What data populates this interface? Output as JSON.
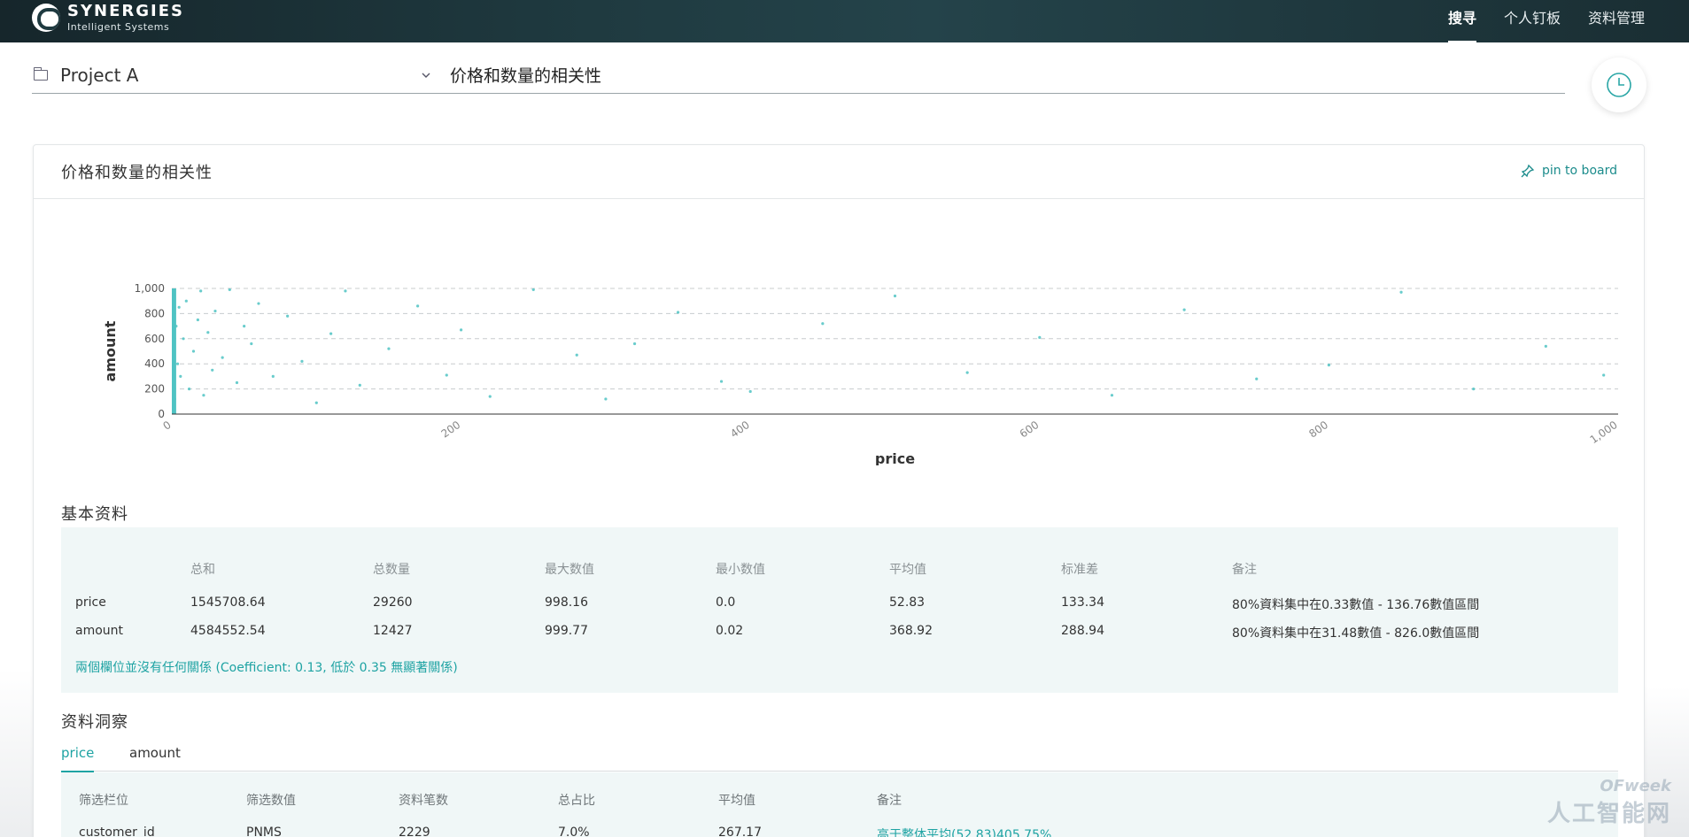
{
  "nav": {
    "brand": "SYNERGIES",
    "brand_sub": "Intelligent Systems",
    "items": [
      {
        "label": "搜寻",
        "active": true
      },
      {
        "label": "个人钉板",
        "active": false
      },
      {
        "label": "资料管理",
        "active": false
      }
    ]
  },
  "query": {
    "project": "Project A",
    "text": "价格和数量的相关性"
  },
  "card": {
    "title": "价格和数量的相关性",
    "pin_label": "pin to board"
  },
  "chart_data": {
    "type": "scatter",
    "xlabel": "price",
    "ylabel": "amount",
    "xlim": [
      0,
      1000
    ],
    "ylim": [
      0,
      1000
    ],
    "x_ticks": [
      "0",
      "200",
      "400",
      "600",
      "800",
      "1,000"
    ],
    "y_ticks": [
      "0",
      "200",
      "400",
      "600",
      "800",
      "1,000"
    ],
    "grid": "horizontal dashed",
    "color": "#4fc3c3",
    "series": [
      {
        "x": [
          1,
          2,
          3,
          4,
          5,
          6,
          8,
          10,
          12,
          15,
          18,
          20,
          22,
          25,
          28,
          30,
          35,
          40,
          45,
          50,
          55,
          60,
          70,
          80,
          90,
          100,
          110,
          120,
          130,
          150,
          170,
          190,
          200,
          220,
          250,
          280,
          300,
          320,
          350,
          380,
          400,
          450,
          500,
          550,
          600,
          650,
          700,
          750,
          800,
          850,
          900,
          950,
          990
        ],
        "y": [
          950,
          120,
          700,
          400,
          850,
          300,
          600,
          900,
          200,
          500,
          750,
          980,
          150,
          650,
          350,
          820,
          450,
          990,
          250,
          700,
          560,
          880,
          300,
          780,
          420,
          90,
          640,
          980,
          230,
          520,
          860,
          310,
          670,
          140,
          990,
          470,
          120,
          560,
          810,
          260,
          180,
          720,
          940,
          330,
          610,
          150,
          830,
          280,
          390,
          970,
          200,
          540,
          310
        ]
      }
    ]
  },
  "basic": {
    "title": "基本资料",
    "headers": [
      "总和",
      "总数量",
      "最大数值",
      "最小数值",
      "平均值",
      "标准差",
      "备注"
    ],
    "rows": [
      {
        "name": "price",
        "cells": [
          "1545708.64",
          "29260",
          "998.16",
          "0.0",
          "52.83",
          "133.34",
          "80%資料集中在0.33數值 - 136.76數值區間"
        ]
      },
      {
        "name": "amount",
        "cells": [
          "4584552.54",
          "12427",
          "999.77",
          "0.02",
          "368.92",
          "288.94",
          "80%資料集中在31.48數值 - 826.0數值區間"
        ]
      }
    ],
    "note": "兩個欄位並沒有任何關係 (Coefficient: 0.13, 低於 0.35 無顯著關係)"
  },
  "insight": {
    "title": "资料洞察",
    "tabs": [
      {
        "label": "price",
        "active": true
      },
      {
        "label": "amount",
        "active": false
      }
    ],
    "headers": [
      "筛选栏位",
      "筛选数值",
      "资料笔数",
      "总占比",
      "平均值",
      "备注"
    ],
    "rows": [
      {
        "cells": [
          "customer_id",
          "PNMS",
          "2229",
          "7.0%",
          "267.17",
          "高于整体平均(52.83)405.75%"
        ]
      }
    ]
  },
  "watermark": {
    "top": "OFweek",
    "bottom": "人工智能网"
  }
}
